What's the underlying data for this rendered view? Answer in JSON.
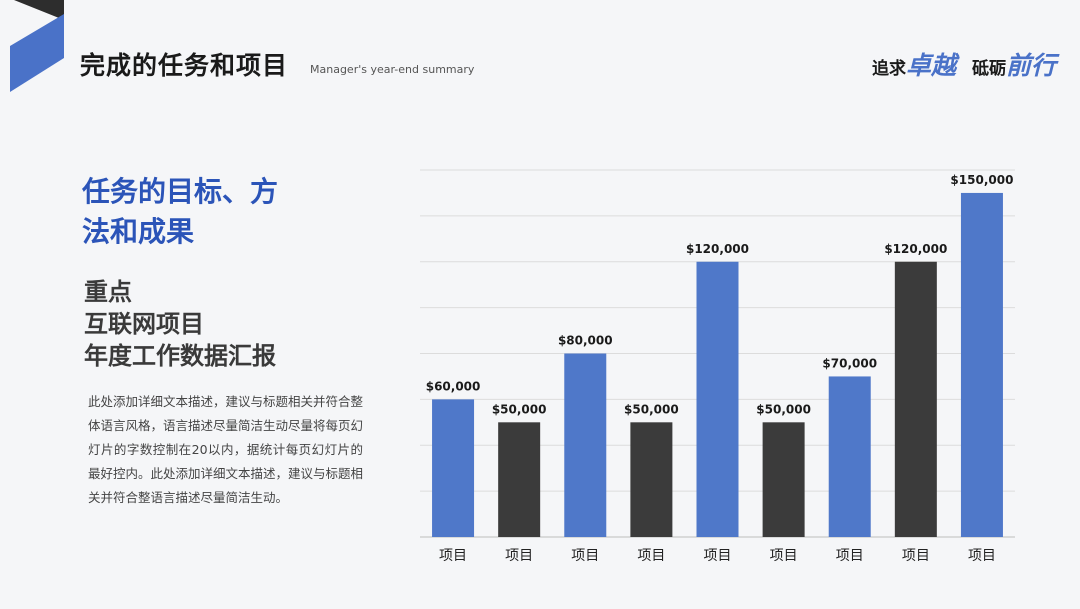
{
  "header": {
    "title": "完成的任务和项目",
    "subtitle": "Manager's year-end summary",
    "slogan": {
      "part1": "追求",
      "accent1": "卓越",
      "part2": "砥砺",
      "accent2": "前行"
    }
  },
  "left": {
    "heading_line1": "任务的目标、方",
    "heading_line2": "法和成果",
    "sub_line1": "重点",
    "sub_line2": "互联网项目",
    "sub_line3": "年度工作数据汇报",
    "description": "此处添加详细文本描述，建议与标题相关并符合整体语言风格，语言描述尽量简洁生动尽量将每页幻灯片的字数控制在20以内，据统计每页幻灯片的最好控内。此处添加详细文本描述，建议与标题相关并符合整语言描述尽量简洁生动。"
  },
  "colors": {
    "blue": "#4f78c9",
    "dark": "#3b3b3b",
    "heading_blue": "#2b54b8"
  },
  "chart_data": {
    "type": "bar",
    "categories": [
      "项目",
      "项目",
      "项目",
      "项目",
      "项目",
      "项目",
      "项目",
      "项目",
      "项目"
    ],
    "values": [
      60000,
      50000,
      80000,
      50000,
      120000,
      50000,
      70000,
      120000,
      150000
    ],
    "value_labels": [
      "$60,000",
      "$50,000",
      "$80,000",
      "$50,000",
      "$120,000",
      "$50,000",
      "$70,000",
      "$120,000",
      "$150,000"
    ],
    "bar_colors": [
      "blue",
      "dark",
      "blue",
      "dark",
      "blue",
      "dark",
      "blue",
      "dark",
      "blue"
    ],
    "ylim": [
      0,
      160000
    ],
    "grid": true
  }
}
